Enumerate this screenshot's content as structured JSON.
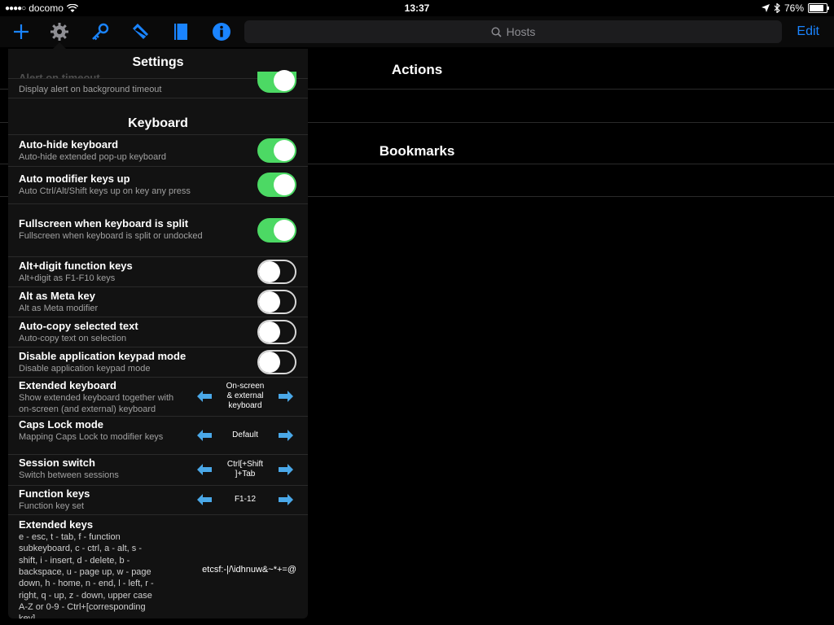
{
  "status_bar": {
    "carrier": "docomo",
    "time": "13:37",
    "battery": "76%",
    "battery_level": 0.76
  },
  "toolbar": {
    "icons": [
      "plus-icon",
      "gear-icon",
      "key-icon",
      "tag-icon",
      "book-icon",
      "info-icon"
    ],
    "search_placeholder": "Hosts",
    "edit_label": "Edit",
    "accent": "#1a84ff"
  },
  "main": {
    "actions_title": "Actions",
    "bookmarks_title": "Bookmarks"
  },
  "settings": {
    "title": "Settings",
    "partial_row": {
      "title": "Alert on timeout",
      "subtitle": "Display alert on background timeout",
      "on": true
    },
    "keyboard_section": "Keyboard",
    "toggles": [
      {
        "title": "Auto-hide keyboard",
        "subtitle": "Auto-hide extended pop-up keyboard",
        "on": true
      },
      {
        "title": "Auto modifier keys up",
        "subtitle": "Auto Ctrl/Alt/Shift keys up on key any press",
        "on": true
      },
      {
        "title": "Fullscreen when keyboard is split",
        "subtitle": "Fullscreen when keyboard is split or undocked",
        "on": true
      },
      {
        "title": "Alt+digit function keys",
        "subtitle": "Alt+digit as F1-F10 keys",
        "on": false
      },
      {
        "title": "Alt as Meta key",
        "subtitle": "Alt as Meta modifier",
        "on": false
      },
      {
        "title": "Auto-copy selected text",
        "subtitle": "Auto-copy text on selection",
        "on": false
      },
      {
        "title": "Disable application keypad mode",
        "subtitle": "Disable application keypad mode",
        "on": false
      }
    ],
    "selectors": [
      {
        "title": "Extended keyboard",
        "subtitle_lines": [
          "Show extended keyboard together with",
          "on-screen (and external) keyboard"
        ],
        "value_lines": [
          "On-screen",
          "& external",
          "keyboard"
        ]
      },
      {
        "title": "Caps Lock mode",
        "subtitle_lines": [
          "Mapping Caps Lock to modifier keys"
        ],
        "value_lines": [
          "Default"
        ]
      },
      {
        "title": "Session switch",
        "subtitle_lines": [
          "Switch between sessions"
        ],
        "value_lines": [
          "Ctrl[+Shift",
          "]+Tab"
        ]
      },
      {
        "title": "Function keys",
        "subtitle_lines": [
          "Function key set"
        ],
        "value_lines": [
          "F1-12"
        ]
      }
    ],
    "extended_keys": {
      "title": "Extended keys",
      "description_lines": [
        "e - esc, t - tab, f - function",
        "subkeyboard, c - ctrl, a - alt, s -",
        "shift, i - insert, d - delete, b -",
        "backspace, u - page up, w - page",
        "down, h - home, n - end, l - left, r -",
        "right, q - up, z - down, upper case",
        "A-Z or 0-9 - Ctrl+[corresponding",
        "key]"
      ],
      "value": "etcsf:-|/\\idhnuw&~*+=@"
    },
    "toggle_on_color": "#4cd964",
    "arrow_color": "#4aa8e8"
  }
}
